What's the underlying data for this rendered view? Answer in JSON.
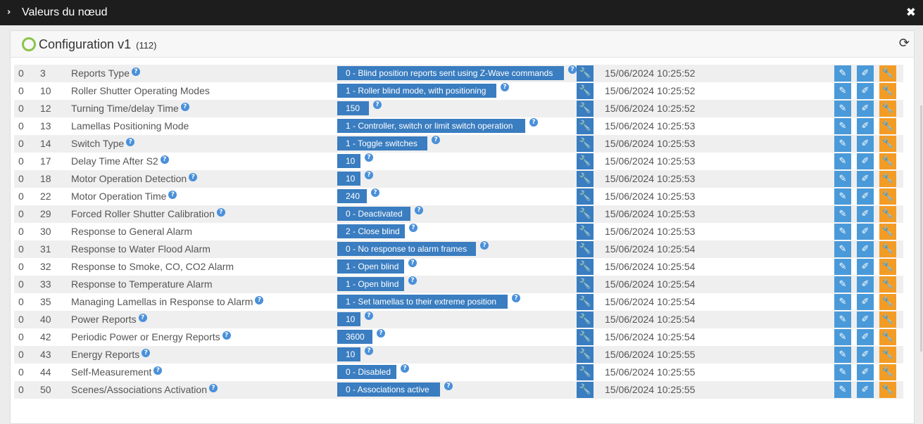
{
  "window": {
    "title": "Valeurs du nœud",
    "chevron": "›",
    "close": "✖"
  },
  "panel": {
    "title": "Configuration v1",
    "count": "(112)",
    "refresh_icon": "⟳"
  },
  "icons": {
    "help": "?",
    "wrench": "🔧",
    "pencil": "✎",
    "edit": "✐",
    "config": "🔧"
  },
  "rows": [
    {
      "instance": "0",
      "index": "3",
      "label": "Reports Type",
      "label_help": true,
      "value": "0 - Blind position reports sent using Z-Wave commands",
      "value_help": true,
      "time": "15/06/2024 10:25:52"
    },
    {
      "instance": "0",
      "index": "10",
      "label": "Roller Shutter Operating Modes",
      "label_help": false,
      "value": "1 - Roller blind mode, with positioning",
      "value_help": true,
      "time": "15/06/2024 10:25:52"
    },
    {
      "instance": "0",
      "index": "12",
      "label": "Turning Time/delay Time",
      "label_help": true,
      "value": "150",
      "value_help": true,
      "time": "15/06/2024 10:25:52"
    },
    {
      "instance": "0",
      "index": "13",
      "label": "Lamellas Positioning Mode",
      "label_help": false,
      "value": "1 - Controller, switch or limit switch operation",
      "value_help": true,
      "time": "15/06/2024 10:25:53"
    },
    {
      "instance": "0",
      "index": "14",
      "label": "Switch Type",
      "label_help": true,
      "value": "1 - Toggle switches",
      "value_help": true,
      "time": "15/06/2024 10:25:53"
    },
    {
      "instance": "0",
      "index": "17",
      "label": "Delay Time After S2",
      "label_help": true,
      "value": "10",
      "value_help": true,
      "time": "15/06/2024 10:25:53"
    },
    {
      "instance": "0",
      "index": "18",
      "label": "Motor Operation Detection",
      "label_help": true,
      "value": "10",
      "value_help": true,
      "time": "15/06/2024 10:25:53"
    },
    {
      "instance": "0",
      "index": "22",
      "label": "Motor Operation Time",
      "label_help": true,
      "value": "240",
      "value_help": true,
      "time": "15/06/2024 10:25:53"
    },
    {
      "instance": "0",
      "index": "29",
      "label": "Forced Roller Shutter Calibration",
      "label_help": true,
      "value": "0 - Deactivated",
      "value_help": true,
      "time": "15/06/2024 10:25:53"
    },
    {
      "instance": "0",
      "index": "30",
      "label": "Response to General Alarm",
      "label_help": false,
      "value": "2 - Close blind",
      "value_help": true,
      "time": "15/06/2024 10:25:53"
    },
    {
      "instance": "0",
      "index": "31",
      "label": "Response to Water Flood Alarm",
      "label_help": false,
      "value": "0 - No response to alarm frames",
      "value_help": true,
      "time": "15/06/2024 10:25:54"
    },
    {
      "instance": "0",
      "index": "32",
      "label": "Response to Smoke, CO, CO2 Alarm",
      "label_help": false,
      "value": "1 - Open blind",
      "value_help": true,
      "time": "15/06/2024 10:25:54"
    },
    {
      "instance": "0",
      "index": "33",
      "label": "Response to Temperature Alarm",
      "label_help": false,
      "value": "1 - Open blind",
      "value_help": true,
      "time": "15/06/2024 10:25:54"
    },
    {
      "instance": "0",
      "index": "35",
      "label": "Managing Lamellas in Response to Alarm",
      "label_help": true,
      "value": "1 - Set lamellas to their extreme position",
      "value_help": true,
      "time": "15/06/2024 10:25:54"
    },
    {
      "instance": "0",
      "index": "40",
      "label": "Power Reports",
      "label_help": true,
      "value": "10",
      "value_help": true,
      "time": "15/06/2024 10:25:54"
    },
    {
      "instance": "0",
      "index": "42",
      "label": "Periodic Power or Energy Reports",
      "label_help": true,
      "value": "3600",
      "value_help": true,
      "time": "15/06/2024 10:25:54"
    },
    {
      "instance": "0",
      "index": "43",
      "label": "Energy Reports",
      "label_help": true,
      "value": "10",
      "value_help": true,
      "time": "15/06/2024 10:25:55"
    },
    {
      "instance": "0",
      "index": "44",
      "label": "Self-Measurement",
      "label_help": true,
      "value": "0 - Disabled",
      "value_help": true,
      "time": "15/06/2024 10:25:55"
    },
    {
      "instance": "0",
      "index": "50",
      "label": "Scenes/Associations Activation",
      "label_help": true,
      "value": "0 - Associations active",
      "value_help": true,
      "time": "15/06/2024 10:25:55"
    }
  ]
}
